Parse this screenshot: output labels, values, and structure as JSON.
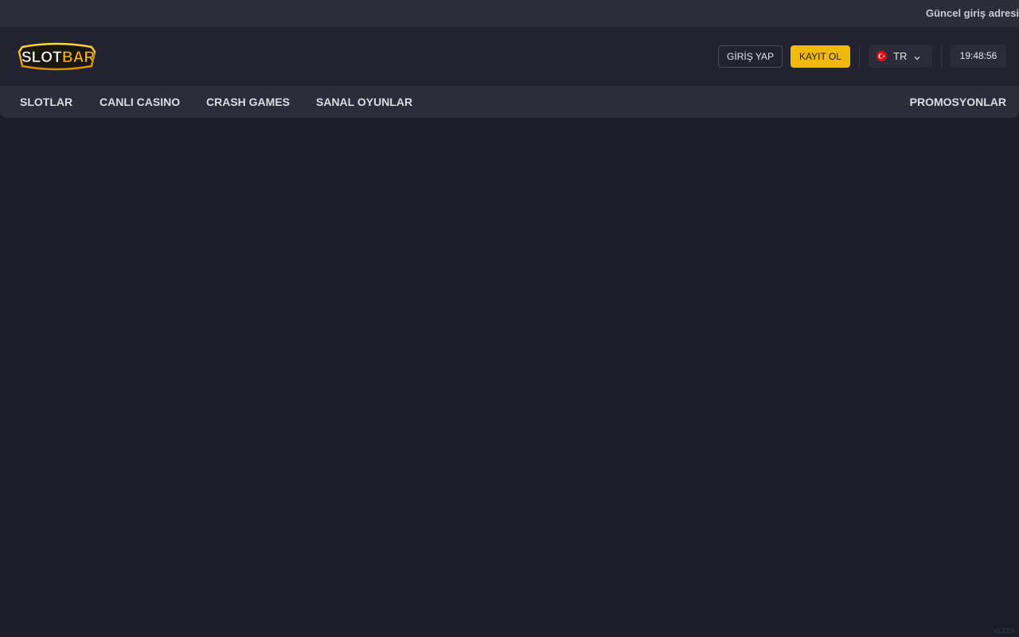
{
  "ticker": {
    "text": "Güncel giriş adresim"
  },
  "header": {
    "logo": {
      "part1": "SLOT",
      "part2": "BAR"
    },
    "login_label": "GİRİŞ YAP",
    "register_label": "KAYIT OL",
    "language": {
      "flag_icon": "turkey-flag-icon",
      "label": "TR",
      "chevron_icon": "chevron-down-icon"
    },
    "clock": "19:48:56"
  },
  "nav": {
    "items": [
      {
        "label": "SLOTLAR"
      },
      {
        "label": "CANLI CASINO"
      },
      {
        "label": "CRASH GAMES"
      },
      {
        "label": "SANAL OYUNLAR"
      }
    ],
    "promotions_label": "PROMOSYONLAR"
  },
  "footer": {
    "version": "v1.12.5"
  },
  "colors": {
    "page_bg": "#1b1e29",
    "header_bg": "#222331",
    "bar_bg": "#2c2d3b",
    "accent": "#f2b90d"
  }
}
